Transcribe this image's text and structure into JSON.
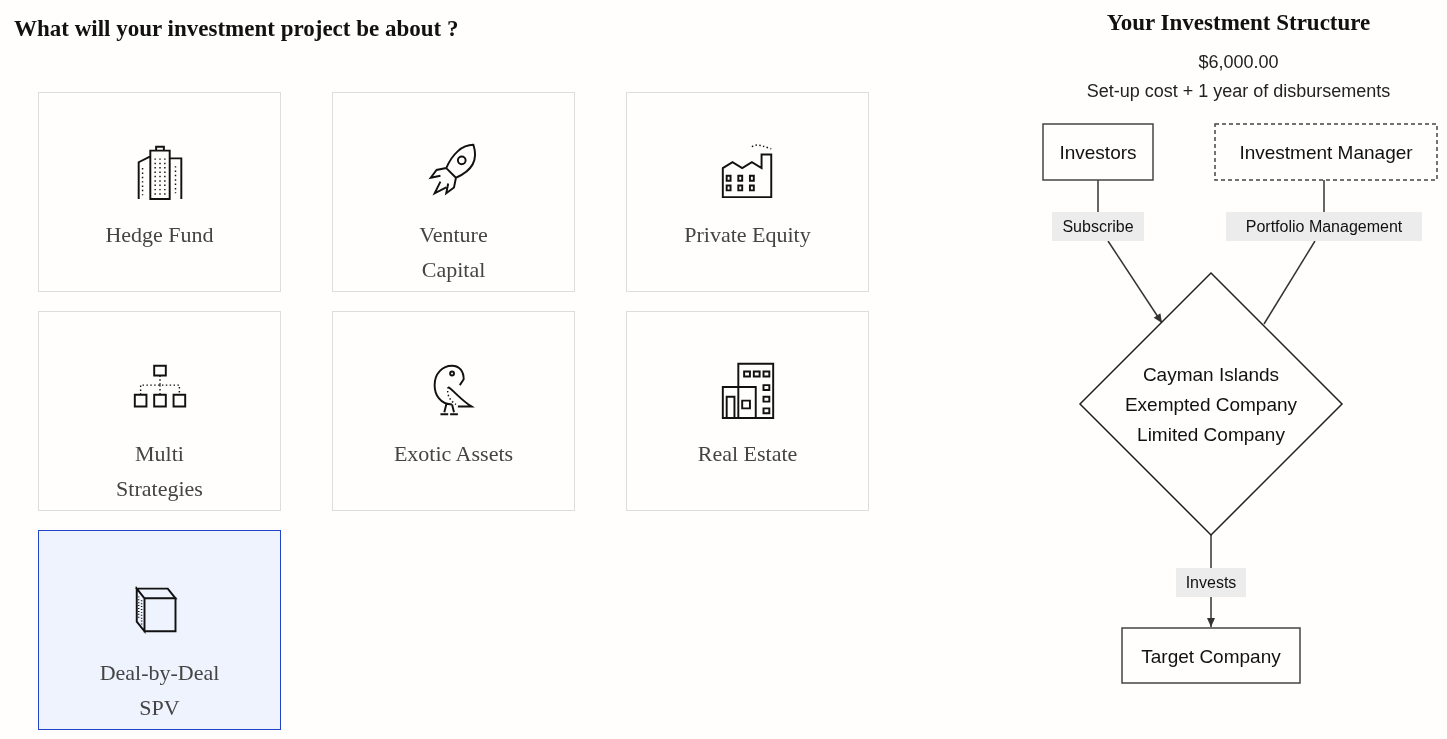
{
  "heading": "What will your investment project be about ?",
  "cards": [
    {
      "label": "Hedge Fund",
      "kind": "buildings",
      "selected": false
    },
    {
      "label": "Venture\nCapital",
      "kind": "rocket",
      "selected": false
    },
    {
      "label": "Private Equity",
      "kind": "factory",
      "selected": false
    },
    {
      "label": "Multi\nStrategies",
      "kind": "orgchart",
      "selected": false
    },
    {
      "label": "Exotic Assets",
      "kind": "parrot",
      "selected": false
    },
    {
      "label": "Real Estate",
      "kind": "building",
      "selected": false
    },
    {
      "label": "Deal-by-Deal\nSPV",
      "kind": "cube",
      "selected": true
    }
  ],
  "structure": {
    "title": "Your Investment Structure",
    "price": "$6,000.00",
    "subtitle": "Set-up cost + 1 year of disbursements",
    "nodes": [
      {
        "kind": "box",
        "lines": [
          "Investors"
        ]
      },
      {
        "kind": "dashed",
        "lines": [
          "Investment Manager"
        ]
      },
      {
        "kind": "diamond",
        "lines": [
          "Cayman Islands",
          "Exempted Company",
          "Limited Company"
        ]
      },
      {
        "kind": "box",
        "lines": [
          "Target Company"
        ]
      }
    ],
    "edges": [
      {
        "label": "Subscribe",
        "arrow": true
      },
      {
        "label": "Portfolio Management",
        "arrow": false
      },
      {
        "label": "Invests",
        "arrow": true
      }
    ]
  }
}
